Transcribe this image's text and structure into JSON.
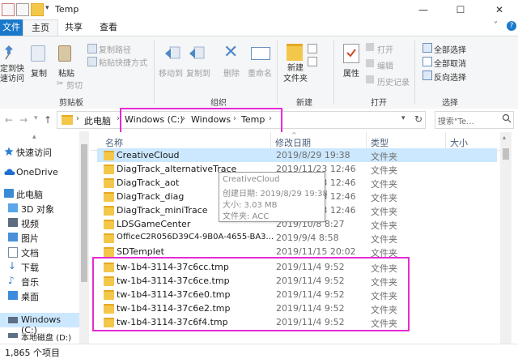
{
  "window": {
    "title": "Temp",
    "minimize": "—",
    "maximize": "☐",
    "close": "✕"
  },
  "tabs": {
    "file": "文件",
    "home": "主页",
    "share": "共享",
    "view": "查看"
  },
  "ribbon": {
    "pin": "固定到快速访问",
    "pin_short": "定到快\n速访问",
    "copy": "复制",
    "paste": "粘贴",
    "copy_path": "复制路径",
    "paste_shortcut": "粘贴快捷方式",
    "cut": "剪切",
    "group_clipboard": "剪贴板",
    "move_to": "移动到",
    "copy_to": "复制到",
    "delete": "删除",
    "rename": "重命名",
    "group_organize": "组织",
    "new_folder": "新建\n文件夹",
    "new_folder_line1": "新建",
    "new_folder_line2": "文件夹",
    "group_new": "新建",
    "properties": "属性",
    "open": "打开",
    "edit": "编辑",
    "history": "历史记录",
    "group_open": "打开",
    "select_all": "全部选择",
    "select_none": "全部取消",
    "invert": "反向选择",
    "group_select": "选择"
  },
  "address": {
    "back": "←",
    "forward": "→",
    "segments": [
      "此电脑",
      "Windows (C:)",
      "Windows",
      "Temp"
    ],
    "search_placeholder": "搜索\"Te...",
    "search_icon": "search-icon"
  },
  "nav": [
    {
      "label": "快速访问",
      "icon": "star-icon",
      "color": "#2a7fd4"
    },
    {
      "label": "OneDrive",
      "icon": "cloud-icon",
      "color": "#1f6fd0"
    },
    {
      "label": "此电脑",
      "icon": "computer-icon",
      "color": "#3b8ad6"
    },
    {
      "label": "3D 对象",
      "icon": "cube-icon",
      "color": "#59a7e8"
    },
    {
      "label": "视频",
      "icon": "video-icon",
      "color": "#5b6c80"
    },
    {
      "label": "图片",
      "icon": "picture-icon",
      "color": "#4a90d9"
    },
    {
      "label": "文档",
      "icon": "document-icon",
      "color": "#7a8aa0"
    },
    {
      "label": "下载",
      "icon": "download-icon",
      "color": "#2f7fd1"
    },
    {
      "label": "音乐",
      "icon": "music-icon",
      "color": "#2f7fd1"
    },
    {
      "label": "桌面",
      "icon": "desktop-icon",
      "color": "#3c8ddc"
    },
    {
      "label": "Windows (C:)",
      "icon": "drive-icon",
      "color": "#5c6f85"
    },
    {
      "label": "本地磁盘 (D:)",
      "icon": "drive-icon",
      "color": "#5c6f85"
    }
  ],
  "columns": {
    "name": "名称",
    "date": "修改日期",
    "type": "类型",
    "size": "大小"
  },
  "files": [
    {
      "name": "CreativeCloud",
      "date": "2019/8/29 19:38",
      "type": "文件夹"
    },
    {
      "name": "DiagTrack_alternativeTrace",
      "date": "2019/11/23 12:46",
      "type": "文件夹"
    },
    {
      "name": "DiagTrack_aot",
      "date": "2019/11/23 12:46",
      "type": "文件夹"
    },
    {
      "name": "DiagTrack_diag",
      "date": "2019/11/23 12:46",
      "type": "文件夹"
    },
    {
      "name": "DiagTrack_miniTrace",
      "date": "2019/11/23 12:46",
      "type": "文件夹"
    },
    {
      "name": "LDSGameCenter",
      "date": "2019/10/8 8:27",
      "type": "文件夹"
    },
    {
      "name": "OfficeC2R056D39C4-9B0A-4655-BA3...",
      "date": "2019/9/4 8:58",
      "type": "文件夹"
    },
    {
      "name": "SDTemplet",
      "date": "2019/11/15 20:02",
      "type": "文件夹"
    },
    {
      "name": "tw-1b4-3114-37c6cc.tmp",
      "date": "2019/11/4 9:52",
      "type": "文件夹"
    },
    {
      "name": "tw-1b4-3114-37c6ce.tmp",
      "date": "2019/11/4 9:52",
      "type": "文件夹"
    },
    {
      "name": "tw-1b4-3114-37c6e0.tmp",
      "date": "2019/11/4 9:52",
      "type": "文件夹"
    },
    {
      "name": "tw-1b4-3114-37c6e2.tmp",
      "date": "2019/11/4 9:52",
      "type": "文件夹"
    },
    {
      "name": "tw-1b4-3114-37c6f4.tmp",
      "date": "2019/11/4 9:52",
      "type": "文件夹"
    }
  ],
  "tooltip": {
    "name": "CreativeCloud",
    "created": "创建日期: 2019/8/29 19:38",
    "size": "大小: 3.03 MB",
    "folder": "文件夹: ACC"
  },
  "status": {
    "count": "1,865 个项目"
  },
  "colors": {
    "accent": "#1979ca",
    "highlight": "#e52bd6",
    "selected_row": "#cce8ff"
  }
}
